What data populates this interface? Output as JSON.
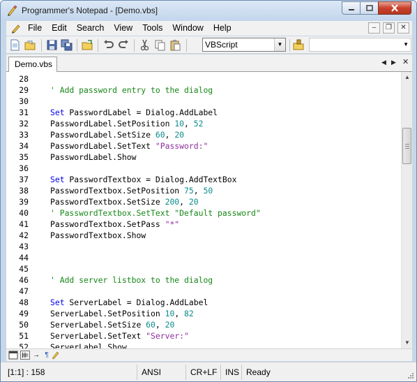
{
  "window": {
    "title": "Programmer's Notepad - [Demo.vbs]"
  },
  "menu": {
    "items": [
      "File",
      "Edit",
      "Search",
      "View",
      "Tools",
      "Window",
      "Help"
    ]
  },
  "toolbar": {
    "scheme": "VBScript",
    "icons": [
      "new-file-icon",
      "open-file-icon",
      "save-icon",
      "save-all-icon",
      "open-project-icon",
      "undo-icon",
      "redo-icon",
      "cut-icon",
      "copy-icon",
      "paste-icon",
      "scheme-config-icon"
    ]
  },
  "tabs": {
    "active": "Demo.vbs"
  },
  "editor": {
    "lines": [
      {
        "n": "28",
        "segments": []
      },
      {
        "n": "29",
        "segments": [
          {
            "t": "' Add password entry to the dialog",
            "c": "cmt"
          }
        ]
      },
      {
        "n": "30",
        "segments": []
      },
      {
        "n": "31",
        "segments": [
          {
            "t": "Set",
            "c": "kw"
          },
          {
            "t": " PasswordLabel = Dialog.AddLabel",
            "c": ""
          }
        ]
      },
      {
        "n": "32",
        "segments": [
          {
            "t": "PasswordLabel.SetPosition ",
            "c": ""
          },
          {
            "t": "10",
            "c": "num"
          },
          {
            "t": ", ",
            "c": ""
          },
          {
            "t": "52",
            "c": "num"
          }
        ]
      },
      {
        "n": "33",
        "segments": [
          {
            "t": "PasswordLabel.SetSize ",
            "c": ""
          },
          {
            "t": "60",
            "c": "num"
          },
          {
            "t": ", ",
            "c": ""
          },
          {
            "t": "20",
            "c": "num"
          }
        ]
      },
      {
        "n": "34",
        "segments": [
          {
            "t": "PasswordLabel.SetText ",
            "c": ""
          },
          {
            "t": "\"Password:\"",
            "c": "str"
          }
        ]
      },
      {
        "n": "35",
        "segments": [
          {
            "t": "PasswordLabel.Show",
            "c": ""
          }
        ]
      },
      {
        "n": "36",
        "segments": []
      },
      {
        "n": "37",
        "segments": [
          {
            "t": "Set",
            "c": "kw"
          },
          {
            "t": " PasswordTextbox = Dialog.AddTextBox",
            "c": ""
          }
        ]
      },
      {
        "n": "38",
        "segments": [
          {
            "t": "PasswordTextbox.SetPosition ",
            "c": ""
          },
          {
            "t": "75",
            "c": "num"
          },
          {
            "t": ", ",
            "c": ""
          },
          {
            "t": "50",
            "c": "num"
          }
        ]
      },
      {
        "n": "39",
        "segments": [
          {
            "t": "PasswordTextbox.SetSize ",
            "c": ""
          },
          {
            "t": "200",
            "c": "num"
          },
          {
            "t": ", ",
            "c": ""
          },
          {
            "t": "20",
            "c": "num"
          }
        ]
      },
      {
        "n": "40",
        "segments": [
          {
            "t": "' PasswordTextbox.SetText \"Default password\"",
            "c": "cmt"
          }
        ]
      },
      {
        "n": "41",
        "segments": [
          {
            "t": "PasswordTextbox.SetPass ",
            "c": ""
          },
          {
            "t": "\"*\"",
            "c": "str"
          }
        ]
      },
      {
        "n": "42",
        "segments": [
          {
            "t": "PasswordTextbox.Show",
            "c": ""
          }
        ]
      },
      {
        "n": "43",
        "segments": []
      },
      {
        "n": "44",
        "segments": []
      },
      {
        "n": "45",
        "segments": []
      },
      {
        "n": "46",
        "segments": [
          {
            "t": "' Add server listbox to the dialog",
            "c": "cmt"
          }
        ]
      },
      {
        "n": "47",
        "segments": []
      },
      {
        "n": "48",
        "segments": [
          {
            "t": "Set",
            "c": "kw"
          },
          {
            "t": " ServerLabel = Dialog.AddLabel",
            "c": ""
          }
        ]
      },
      {
        "n": "49",
        "segments": [
          {
            "t": "ServerLabel.SetPosition ",
            "c": ""
          },
          {
            "t": "10",
            "c": "num"
          },
          {
            "t": ", ",
            "c": ""
          },
          {
            "t": "82",
            "c": "num"
          }
        ]
      },
      {
        "n": "50",
        "segments": [
          {
            "t": "ServerLabel.SetSize ",
            "c": ""
          },
          {
            "t": "60",
            "c": "num"
          },
          {
            "t": ", ",
            "c": ""
          },
          {
            "t": "20",
            "c": "num"
          }
        ]
      },
      {
        "n": "51",
        "segments": [
          {
            "t": "ServerLabel.SetText ",
            "c": ""
          },
          {
            "t": "\"Server:\"",
            "c": "str"
          }
        ]
      },
      {
        "n": "52",
        "segments": [
          {
            "t": "ServerLabel.Show",
            "c": ""
          }
        ]
      }
    ]
  },
  "status": {
    "position": "[1:1] : 158",
    "encoding": "ANSI",
    "line_endings": "CR+LF",
    "insert_mode": "INS",
    "state": "Ready"
  },
  "colors": {
    "keyword": "#0000e6",
    "number": "#0b8c8c",
    "string": "#8e2d9e",
    "comment": "#178717"
  }
}
